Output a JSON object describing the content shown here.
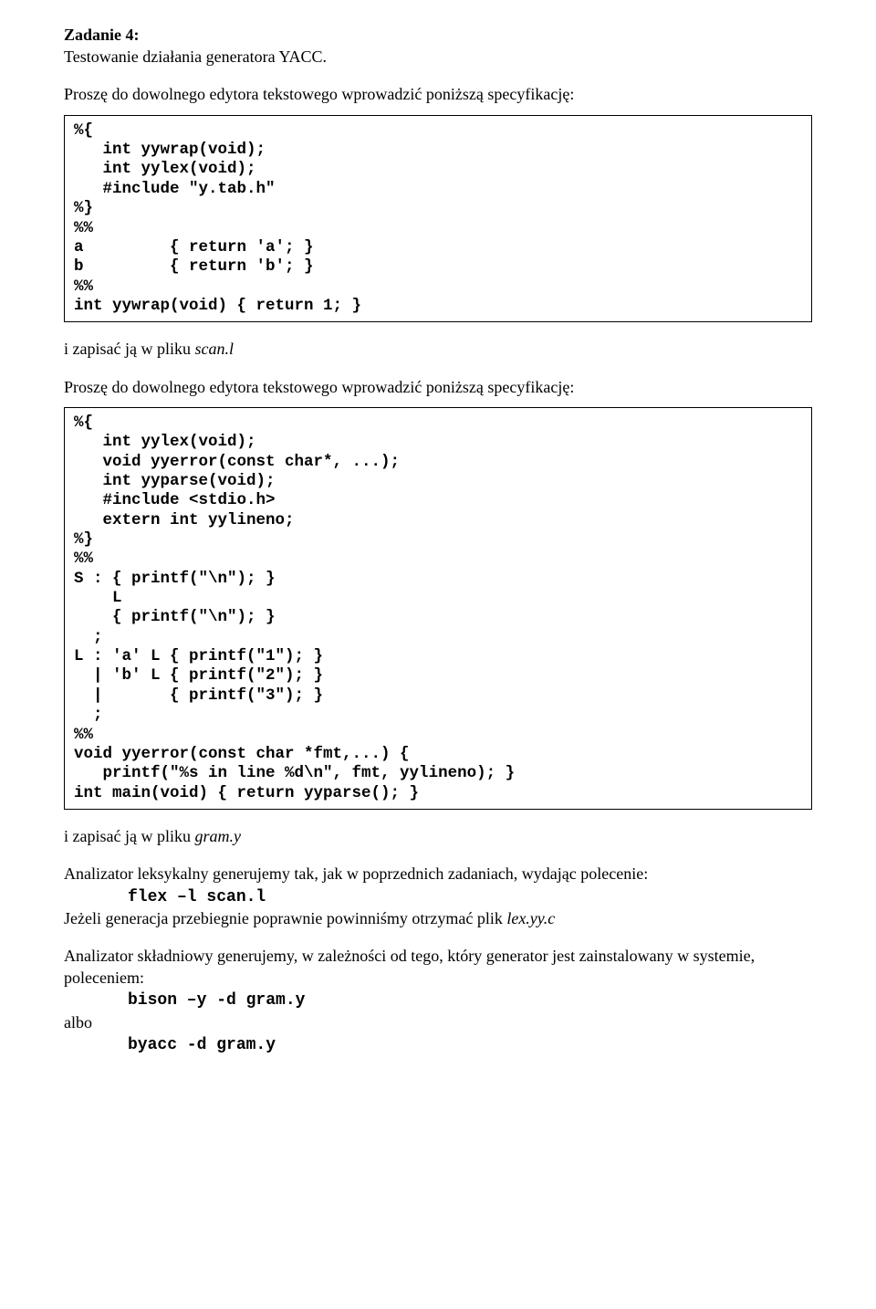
{
  "heading": "Zadanie 4:",
  "subtitle": "Testowanie działania generatora YACC.",
  "intro1": "Proszę do dowolnego edytora tekstowego wprowadzić poniższą specyfikację:",
  "code1": "%{\n   int yywrap(void);\n   int yylex(void);\n   #include \"y.tab.h\"\n%}\n%%\na         { return 'a'; }\nb         { return 'b'; }\n%%\nint yywrap(void) { return 1; }",
  "save1_a": "i zapisać ją w pliku ",
  "save1_b": "scan.l",
  "intro2": "Proszę do dowolnego edytora tekstowego wprowadzić poniższą specyfikację:",
  "code2": "%{\n   int yylex(void);\n   void yyerror(const char*, ...);\n   int yyparse(void);\n   #include <stdio.h>\n   extern int yylineno;\n%}\n%%\nS : { printf(\"\\n\"); }\n    L\n    { printf(\"\\n\"); }\n  ;\nL : 'a' L { printf(\"1\"); }\n  | 'b' L { printf(\"2\"); }\n  |       { printf(\"3\"); }\n  ;\n%%\nvoid yyerror(const char *fmt,...) {\n   printf(\"%s in line %d\\n\", fmt, yylineno); }\nint main(void) { return yyparse(); }",
  "save2_a": "i zapisać ją w pliku ",
  "save2_b": "gram.y",
  "lex_para": "Analizator leksykalny generujemy tak, jak w poprzednich zadaniach, wydając polecenie:",
  "lex_cmd": "flex –l scan.l",
  "lex_after_a": "Jeżeli generacja przebiegnie poprawnie powinniśmy otrzymać plik ",
  "lex_after_b": "lex.yy.c",
  "syn_para": "Analizator składniowy generujemy, w zależności od tego, który generator jest zainstalowany w systemie, poleceniem:",
  "syn_cmd1": "bison –y -d gram.y",
  "albo": "albo",
  "syn_cmd2": "byacc -d gram.y"
}
